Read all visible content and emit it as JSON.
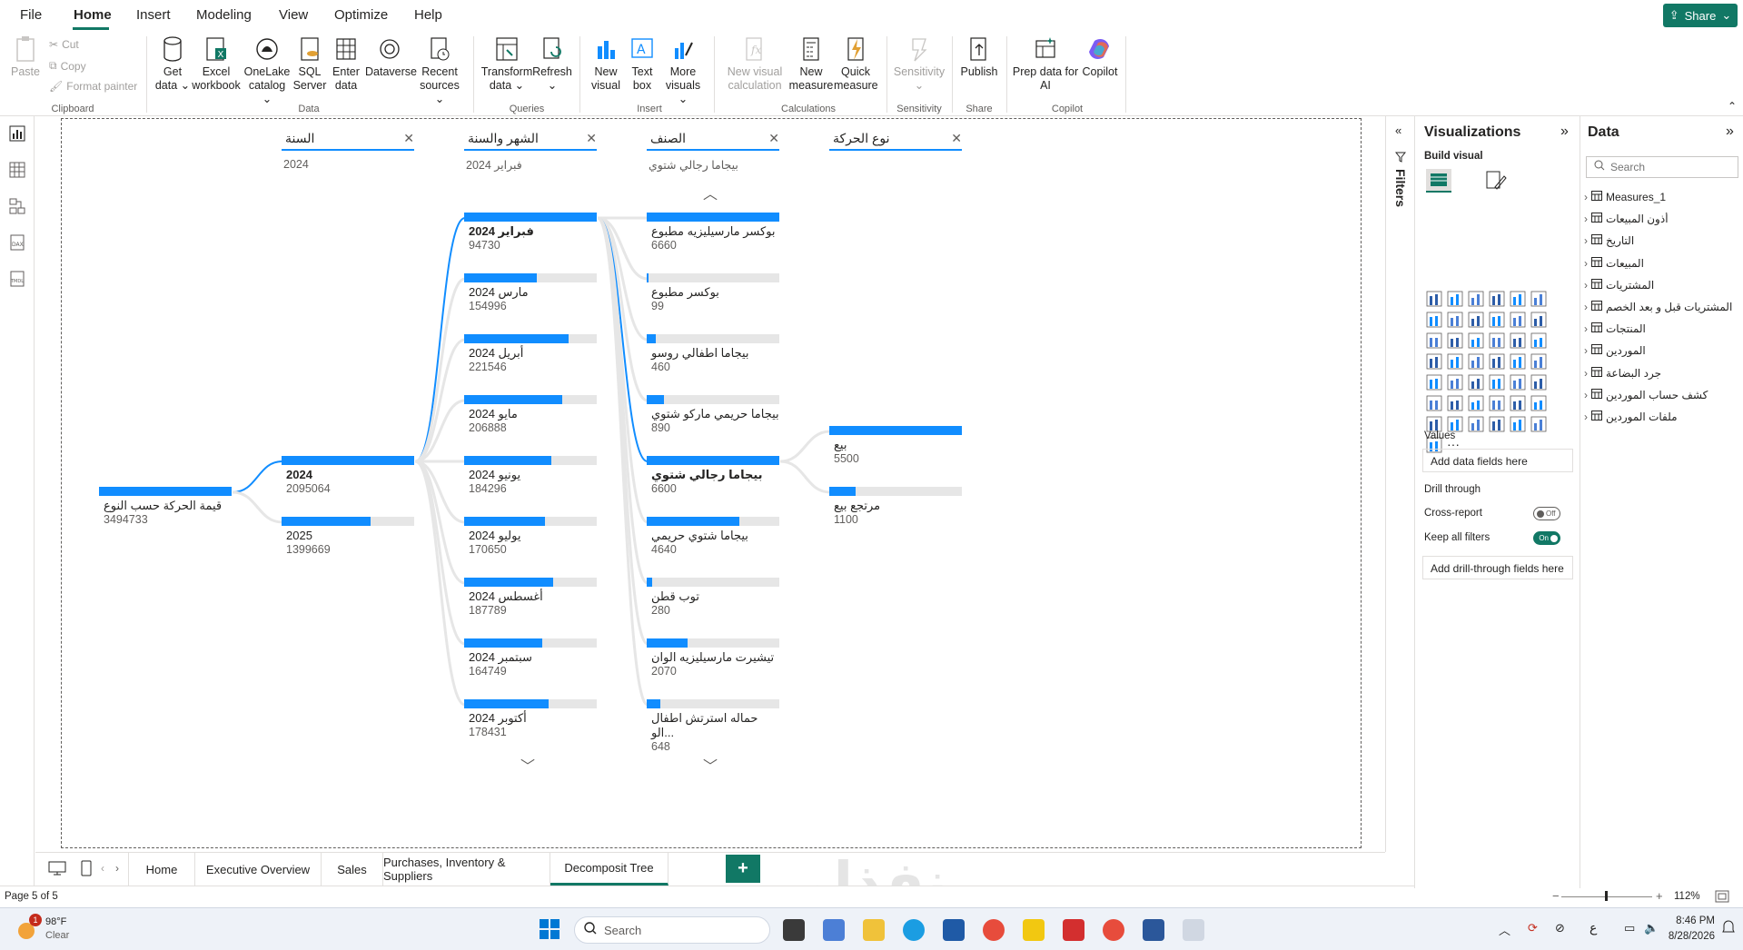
{
  "menu": {
    "items": [
      "File",
      "Home",
      "Insert",
      "Modeling",
      "View",
      "Optimize",
      "Help"
    ],
    "share": "Share"
  },
  "ribbon": {
    "clipboard": {
      "paste": "Paste",
      "cut": "Cut",
      "copy": "Copy",
      "format_painter": "Format painter",
      "label": "Clipboard"
    },
    "data": {
      "get_data": "Get data",
      "excel": "Excel workbook",
      "onelake": "OneLake catalog",
      "sql": "SQL Server",
      "enter": "Enter data",
      "dataverse": "Dataverse",
      "recent": "Recent sources",
      "label": "Data"
    },
    "queries": {
      "transform": "Transform data",
      "refresh": "Refresh",
      "label": "Queries"
    },
    "insert": {
      "new_visual": "New visual",
      "text_box": "Text box",
      "more_visuals": "More visuals",
      "label": "Insert"
    },
    "calculations": {
      "new_visual_calc": "New visual calculation",
      "new_measure": "New measure",
      "quick_measure": "Quick measure",
      "label": "Calculations"
    },
    "sensitivity": {
      "sensitivity": "Sensitivity",
      "label": "Sensitivity"
    },
    "share": {
      "publish": "Publish",
      "label": "Share"
    },
    "copilot": {
      "prep": "Prep data for AI",
      "copilot": "Copilot",
      "label": "Copilot"
    }
  },
  "tree": {
    "headers": [
      {
        "title": "السنة",
        "sub": "2024"
      },
      {
        "title": "الشهر والسنة",
        "sub": "فبراير 2024"
      },
      {
        "title": "الصنف",
        "sub": "بيجاما رجالي شتوي"
      },
      {
        "title": "نوع الحركة",
        "sub": ""
      }
    ],
    "root": {
      "label": "قيمة الحركة حسب النوع",
      "value": "3494733",
      "fill": 1.0
    },
    "years": [
      {
        "label": "2024",
        "value": "2095064",
        "fill": 1.0,
        "selected": true
      },
      {
        "label": "2025",
        "value": "1399669",
        "fill": 0.67,
        "selected": false
      }
    ],
    "months": [
      {
        "label": "فبراير 2024",
        "value": "94730",
        "fill": 0.34,
        "selected": true
      },
      {
        "label": "مارس 2024",
        "value": "154996",
        "fill": 0.55,
        "selected": false
      },
      {
        "label": "أبريل 2024",
        "value": "221546",
        "fill": 0.79,
        "selected": false
      },
      {
        "label": "مايو 2024",
        "value": "206888",
        "fill": 0.74,
        "selected": false
      },
      {
        "label": "يونيو 2024",
        "value": "184296",
        "fill": 0.66,
        "selected": false
      },
      {
        "label": "يوليو 2024",
        "value": "170650",
        "fill": 0.61,
        "selected": false
      },
      {
        "label": "أغسطس 2024",
        "value": "187789",
        "fill": 0.67,
        "selected": false
      },
      {
        "label": "سبتمبر 2024",
        "value": "164749",
        "fill": 0.59,
        "selected": false
      },
      {
        "label": "أكتوبر 2024",
        "value": "178431",
        "fill": 0.64,
        "selected": false
      }
    ],
    "items": [
      {
        "label": "بوكسر مارسيليزيه مطبوع",
        "value": "6660",
        "fill": 1.0,
        "selected": false
      },
      {
        "label": "بوكسر مطبوع",
        "value": "99",
        "fill": 0.015,
        "selected": false
      },
      {
        "label": "بيجاما اطفالي روسو",
        "value": "460",
        "fill": 0.07,
        "selected": false
      },
      {
        "label": "بيجاما حريمي ماركو شتوي",
        "value": "890",
        "fill": 0.13,
        "selected": false
      },
      {
        "label": "بيجاما رجالي شتوي",
        "value": "6600",
        "fill": 0.99,
        "selected": true
      },
      {
        "label": "بيجاما شتوي حريمي",
        "value": "4640",
        "fill": 0.7,
        "selected": false
      },
      {
        "label": "توب قطن",
        "value": "280",
        "fill": 0.04,
        "selected": false
      },
      {
        "label": "تيشيرت مارسيليزيه الوان",
        "value": "2070",
        "fill": 0.31,
        "selected": false
      },
      {
        "label": "حماله استرتش اطفال الو...",
        "value": "648",
        "fill": 0.1,
        "selected": false
      }
    ],
    "types": [
      {
        "label": "بيع",
        "value": "5500",
        "fill": 1.0,
        "selected": false
      },
      {
        "label": "مرتجع بيع",
        "value": "1100",
        "fill": 0.2,
        "selected": false
      }
    ]
  },
  "tabs": [
    "Home",
    "Executive Overview",
    "Sales",
    "Purchases, Inventory & Suppliers",
    "Decomposit Tree"
  ],
  "status": {
    "page": "Page 5 of 5",
    "zoom": "112%"
  },
  "filters": {
    "label": "Filters"
  },
  "viz": {
    "title": "Visualizations",
    "build": "Build visual",
    "values": "Values",
    "add_fields": "Add data fields here",
    "drill": "Drill through",
    "cross_report": "Cross-report",
    "cross_state": "Off",
    "keep_filters": "Keep all filters",
    "keep_state": "On",
    "add_drill": "Add drill-through fields here"
  },
  "data_pane": {
    "title": "Data",
    "search_placeholder": "Search",
    "tables": [
      "Measures_1",
      "أذون المبيعات",
      "التاريخ",
      "المبيعات",
      "المشتريات",
      "المشتريات قبل و بعد الخصم",
      "المنتجات",
      "الموردين",
      "جرد البضاعة",
      "كشف حساب الموردين",
      "ملفات الموردين"
    ]
  },
  "taskbar": {
    "temp": "98°F",
    "weather": "Clear",
    "search": "Search",
    "time": "8:46 PM",
    "date": "8/28/2026",
    "lang": "ع",
    "badge": "1"
  },
  "watermark": "نفذلي",
  "colors": {
    "accent": "#117865",
    "bar": "#118dff",
    "track": "#e6e6e6"
  }
}
